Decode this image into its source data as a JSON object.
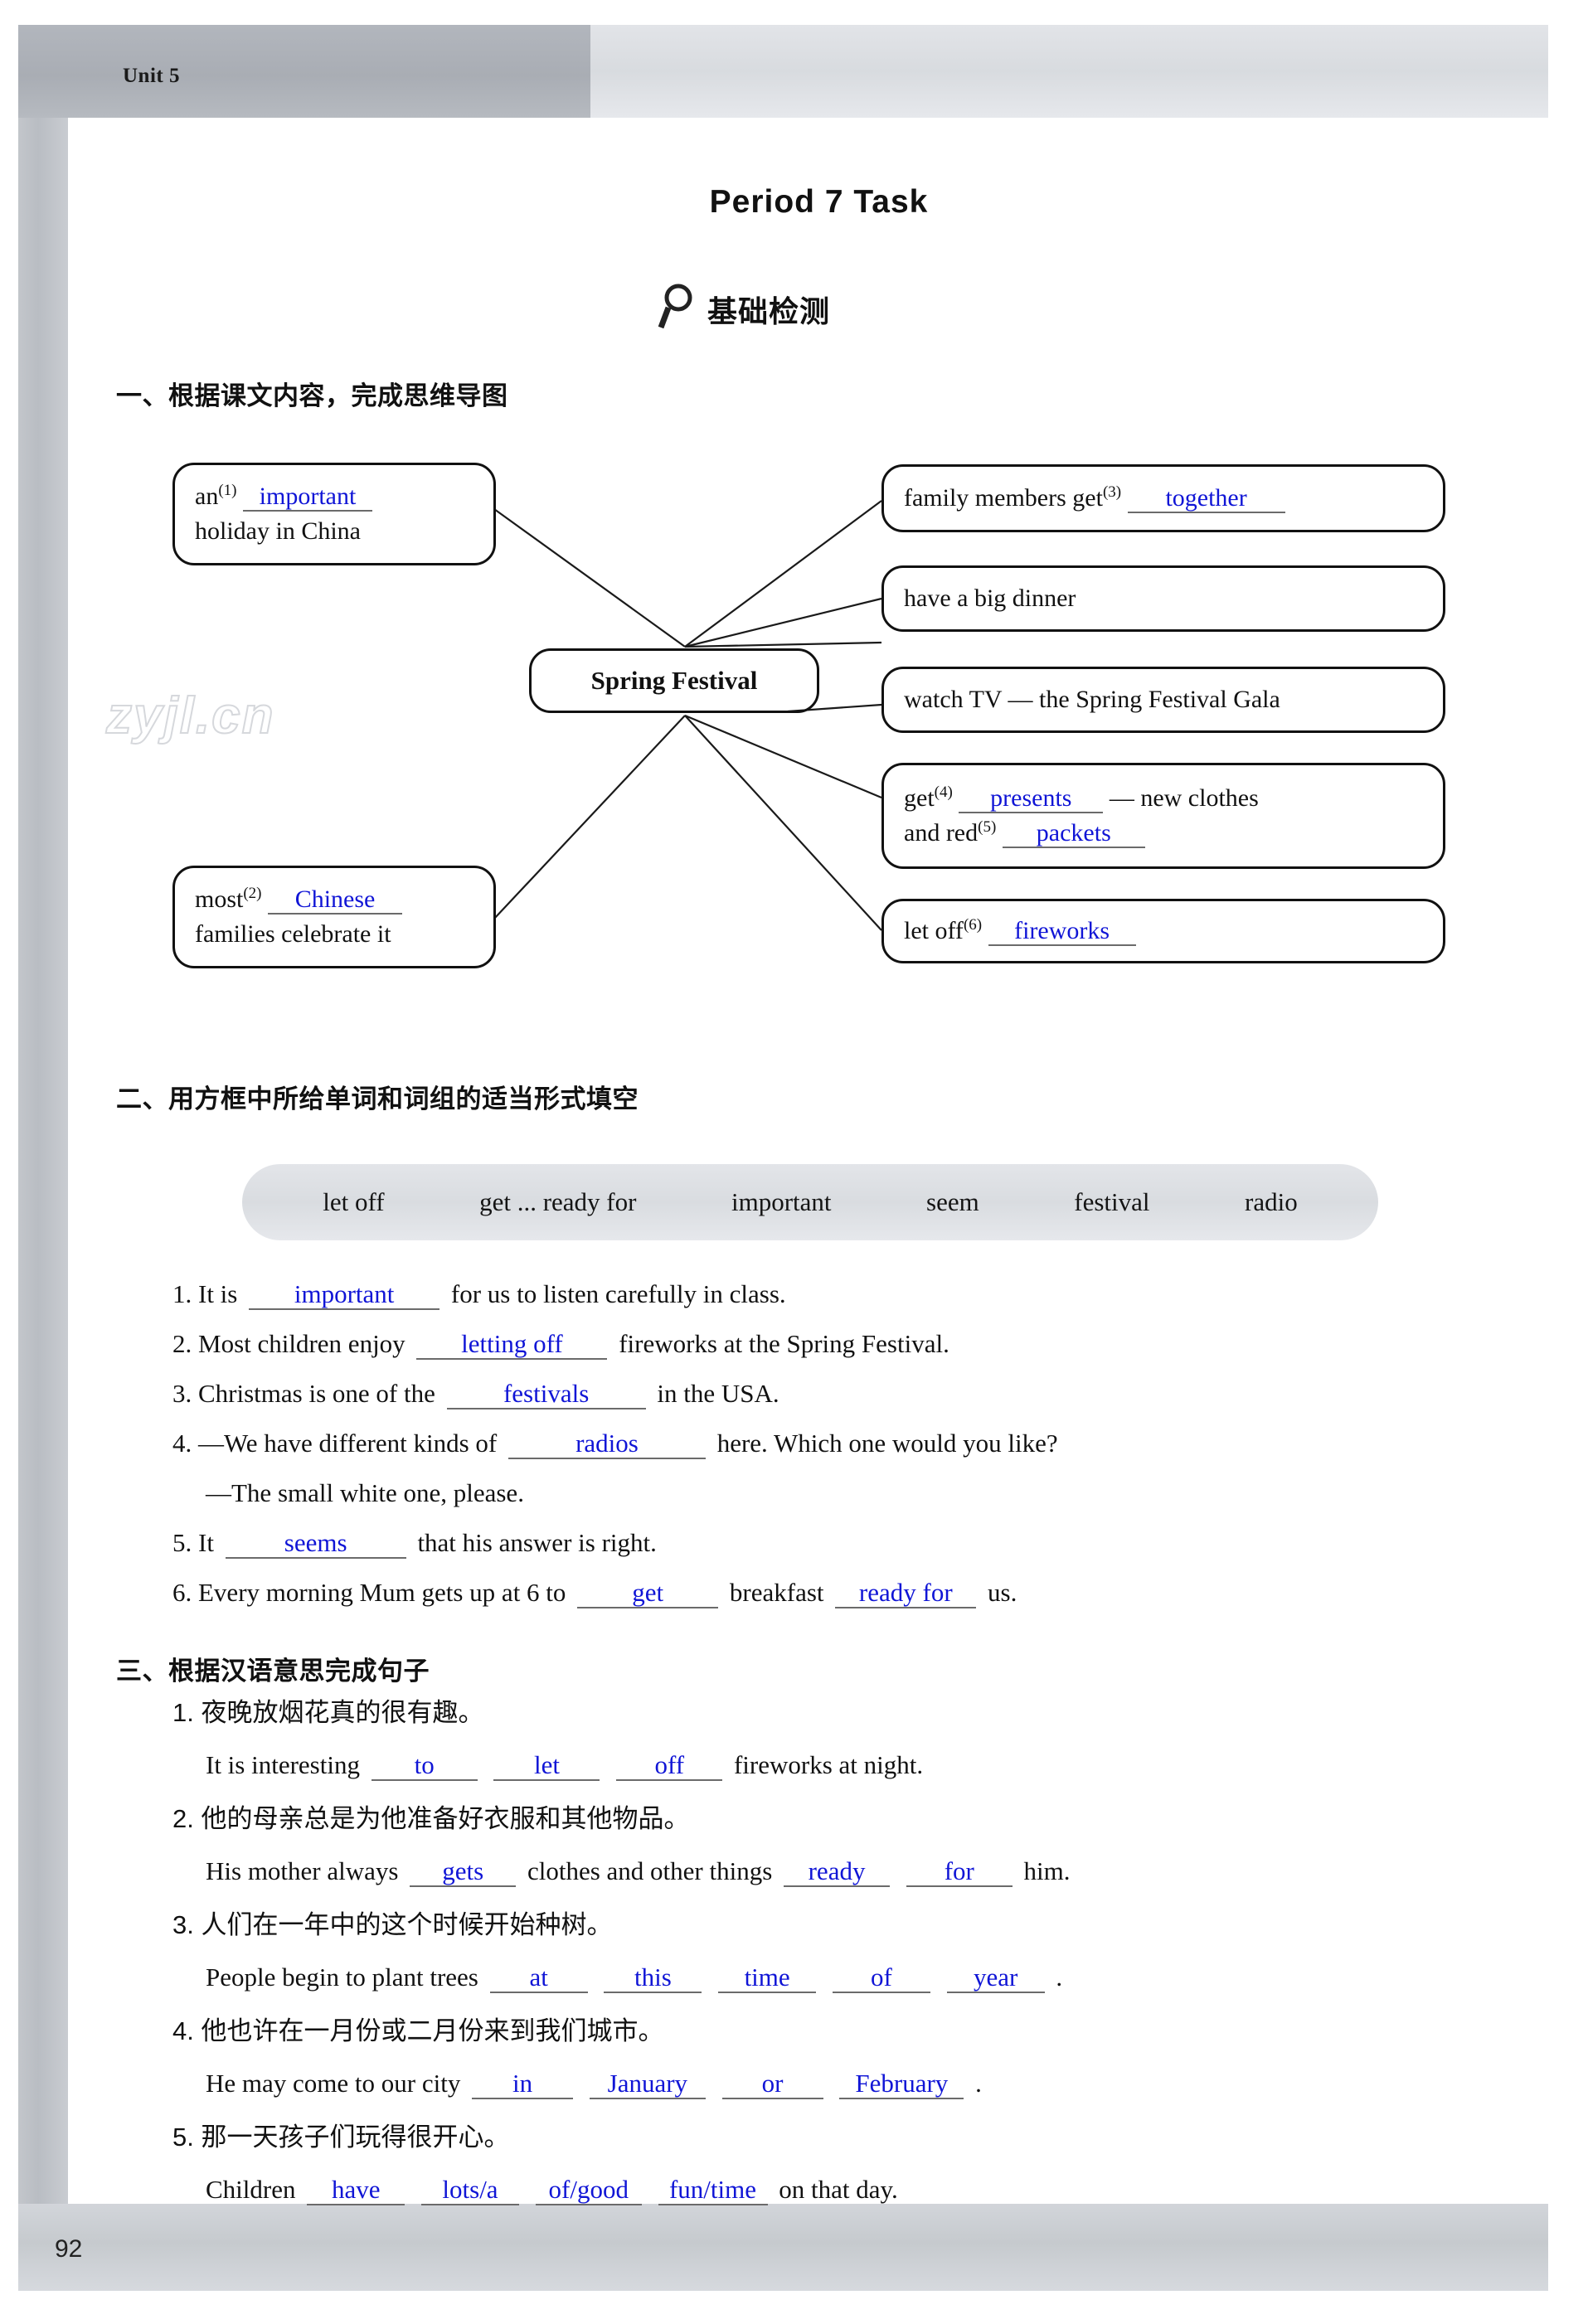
{
  "page": {
    "unit_label": "Unit 5",
    "page_number": "92",
    "title": "Period 7   Task",
    "section_badge": "基础检测",
    "badge_icon": "magnifier-icon",
    "watermark": "zyjl.cn",
    "answer_color": "#1015d6"
  },
  "sections": {
    "one": {
      "heading": "一、根据课文内容，完成思维导图"
    },
    "two": {
      "heading": "二、用方框中所给单词和词组的适当形式填空"
    },
    "three": {
      "heading": "三、根据汉语意思完成句子"
    }
  },
  "mindmap": {
    "center": "Spring Festival",
    "left_nodes": [
      {
        "id": "left-top",
        "pre": "an",
        "num": "(1)",
        "answer": "important",
        "line2": "holiday in China"
      },
      {
        "id": "left-bottom",
        "pre": "most",
        "num": "(2)",
        "answer": "Chinese",
        "line2": "families celebrate it"
      }
    ],
    "right_nodes": [
      {
        "id": "r1",
        "pre": "family members get",
        "num": "(3)",
        "answer": "together",
        "post": ""
      },
      {
        "id": "r2",
        "text": "have a big dinner"
      },
      {
        "id": "r3",
        "text": "watch TV — the Spring Festival Gala"
      },
      {
        "id": "r4",
        "pre": "get",
        "num": "(4)",
        "answer": "presents",
        "post": "— new clothes",
        "pre2": "and red",
        "num2": "(5)",
        "answer2": "packets"
      },
      {
        "id": "r5",
        "pre": "let off",
        "num": "(6)",
        "answer": "fireworks",
        "post": ""
      }
    ]
  },
  "word_bank": [
    "let off",
    "get ... ready for",
    "important",
    "seem",
    "festival",
    "radio"
  ],
  "exercises_two": [
    {
      "num": "1.",
      "pre": "It is",
      "answer": "important",
      "post": "for us to listen carefully in class."
    },
    {
      "num": "2.",
      "pre": "Most children enjoy",
      "answer": "letting off",
      "post": "fireworks at the Spring Festival."
    },
    {
      "num": "3.",
      "pre": "Christmas is one of the",
      "answer": "festivals",
      "post": "in the USA."
    },
    {
      "num": "4.",
      "pre": "—We have different kinds of",
      "answer": "radios",
      "post": "here. Which one would you like?"
    },
    {
      "num": "",
      "pre": "—The small white one, please.",
      "answer": "",
      "post": ""
    },
    {
      "num": "5.",
      "pre": "It",
      "answer": "seems",
      "post": "that his answer is right."
    },
    {
      "num": "6.",
      "pre": "Every morning Mum gets up at 6 to",
      "answer": "get",
      "mid": "breakfast",
      "answer2": "ready for",
      "post": "us."
    }
  ],
  "exercises_three": [
    {
      "num": "1.",
      "chinese": "夜晚放烟花真的很有趣。",
      "pre": "It is interesting",
      "blanks": [
        "to",
        "let",
        "off"
      ],
      "post": "fireworks at night."
    },
    {
      "num": "2.",
      "chinese": "他的母亲总是为他准备好衣服和其他物品。",
      "pre": "His mother always",
      "blanks": [
        "gets"
      ],
      "mid": "clothes and other things",
      "blanks2": [
        "ready",
        "for"
      ],
      "post": "him."
    },
    {
      "num": "3.",
      "chinese": "人们在一年中的这个时候开始种树。",
      "pre": "People begin to plant trees",
      "blanks": [
        "at",
        "this",
        "time",
        "of",
        "year"
      ],
      "post": "."
    },
    {
      "num": "4.",
      "chinese": "他也许在一月份或二月份来到我们城市。",
      "pre": "He may come to our city",
      "blanks": [
        "in",
        "January",
        "or",
        "February"
      ],
      "post": "."
    },
    {
      "num": "5.",
      "chinese": "那一天孩子们玩得很开心。",
      "pre": "Children",
      "blanks": [
        "have",
        "lots/a",
        "of/good",
        "fun/time"
      ],
      "post": "on that day."
    }
  ]
}
